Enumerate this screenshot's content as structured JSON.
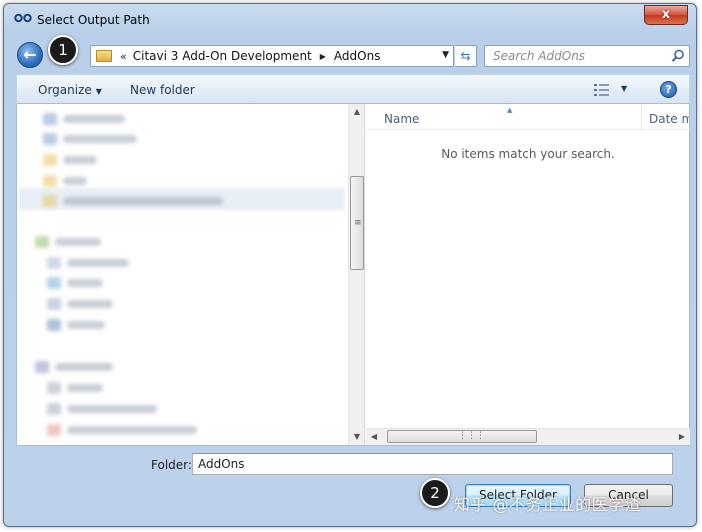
{
  "window": {
    "title": "Select Output Path"
  },
  "close_label": "x",
  "nav": {
    "back_glyph": "←",
    "breadcrumb_prefix": "«",
    "breadcrumb": [
      "Citavi 3 Add-On Development",
      "AddOns"
    ],
    "search_placeholder": "Search AddOns"
  },
  "annotations": {
    "step1": "1",
    "step2": "2"
  },
  "toolbar": {
    "organize_label": "Organize",
    "new_folder_label": "New folder",
    "help_glyph": "?"
  },
  "content": {
    "columns": {
      "name": "Name",
      "date_modified": "Date modified"
    },
    "empty_message": "No items match your search."
  },
  "footer": {
    "folder_label": "Folder:",
    "folder_value": "AddOns",
    "select_button": "Select Folder",
    "cancel_button": "Cancel"
  },
  "watermark": "知乎 @不务正业的医学渣",
  "colors": {
    "accent": "#3777c1",
    "title_bg": "#c9dbef",
    "close_red": "#c23a22"
  }
}
